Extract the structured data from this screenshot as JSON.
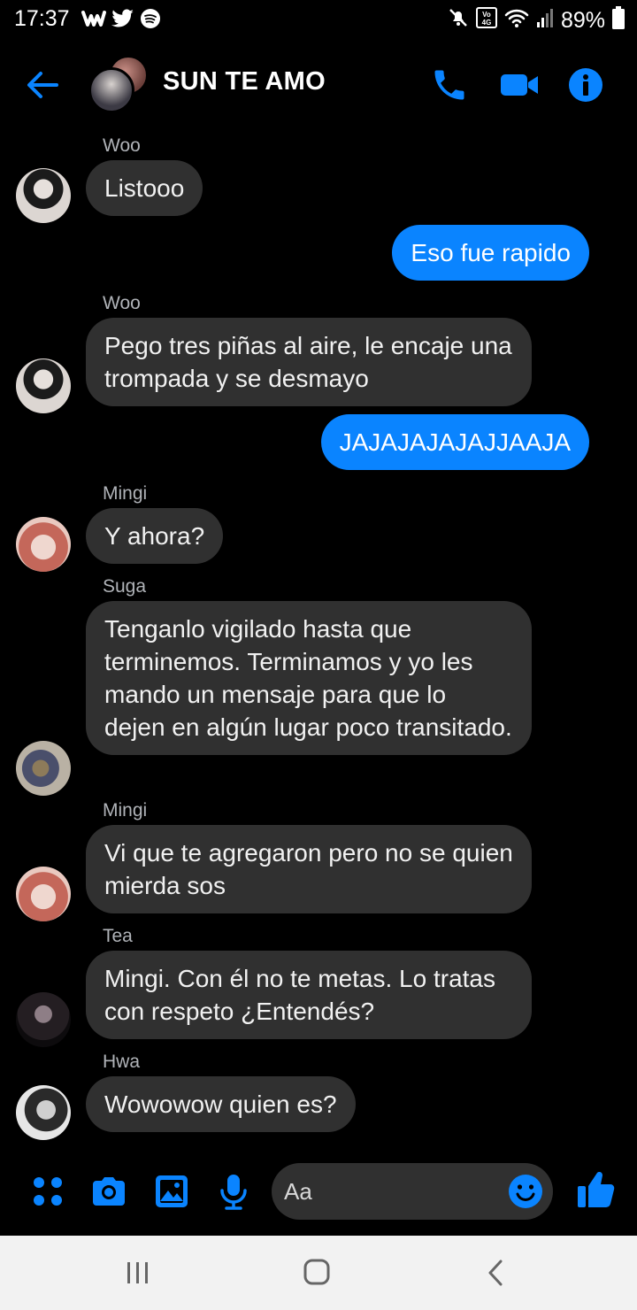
{
  "status_bar": {
    "time": "17:37",
    "battery": "89%",
    "left_icons": [
      "wattpad-icon",
      "twitter-icon",
      "spotify-icon"
    ],
    "right_icons": [
      "mute-icon",
      "volte-icon",
      "wifi-icon",
      "signal-icon",
      "battery-icon"
    ],
    "volte_label": "Vo 4G"
  },
  "header": {
    "title": "SUN TE AMO",
    "accent_color": "#0a84ff"
  },
  "messages": [
    {
      "sender": "Woo",
      "direction": "in",
      "text": "Listooo",
      "avatar": "woo"
    },
    {
      "direction": "out",
      "text": "Eso fue rapido"
    },
    {
      "sender": "Woo",
      "direction": "in",
      "text": "Pego tres piñas al aire, le encaje una trompada y se desmayo",
      "avatar": "woo"
    },
    {
      "direction": "out",
      "text": "JAJAJAJAJAJJAAJA"
    },
    {
      "sender": "Mingi",
      "direction": "in",
      "text": "Y ahora?",
      "avatar": "mingi"
    },
    {
      "sender": "Suga",
      "direction": "in",
      "text": "Tenganlo vigilado hasta que terminemos. Terminamos y yo les mando un mensaje para que lo dejen en algún lugar poco transitado.",
      "avatar": "suga"
    },
    {
      "sender": "Mingi",
      "direction": "in",
      "text": "Vi que te agregaron pero no se quien mierda sos",
      "avatar": "mingi"
    },
    {
      "sender": "Tea",
      "direction": "in",
      "text": "Mingi. Con él no te metas. Lo tratas con respeto ¿Entendés?",
      "avatar": "tea"
    },
    {
      "sender": "Hwa",
      "direction": "in",
      "text": "Wowowow quien es?",
      "avatar": "hwa"
    }
  ],
  "composer": {
    "placeholder": "Aa"
  }
}
